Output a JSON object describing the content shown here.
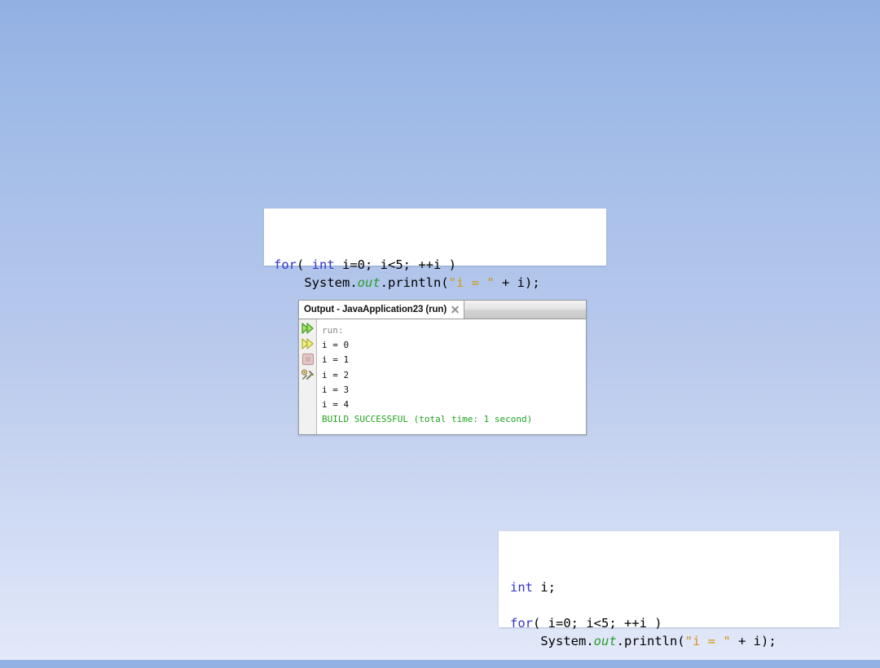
{
  "background": {
    "top_color": "#92b0e3",
    "bottom_color": "#e3e9f9"
  },
  "code_top": {
    "name": "for-loop-code-snippet",
    "lines": [
      [
        {
          "t": "for",
          "c": "kw"
        },
        {
          "t": "( ",
          "c": "plain"
        },
        {
          "t": "int",
          "c": "kw"
        },
        {
          "t": " i=0; i<5; ++i )",
          "c": "plain"
        }
      ],
      [
        {
          "t": "    System.",
          "c": "plain"
        },
        {
          "t": "out",
          "c": "field"
        },
        {
          "t": ".println(",
          "c": "plain"
        },
        {
          "t": "\"i = \"",
          "c": "str"
        },
        {
          "t": " + i);",
          "c": "plain"
        }
      ]
    ]
  },
  "code_bottom": {
    "name": "declared-variable-code-snippet",
    "lines": [
      [
        {
          "t": "int",
          "c": "kw"
        },
        {
          "t": " i;",
          "c": "plain"
        }
      ],
      [
        {
          "t": "",
          "c": "plain"
        }
      ],
      [
        {
          "t": "for",
          "c": "kw"
        },
        {
          "t": "( i=0; i<5; ++i )",
          "c": "plain"
        }
      ],
      [
        {
          "t": "    System.",
          "c": "plain"
        },
        {
          "t": "out",
          "c": "field"
        },
        {
          "t": ".println(",
          "c": "plain"
        },
        {
          "t": "\"i = \"",
          "c": "str"
        },
        {
          "t": " + i);",
          "c": "plain"
        }
      ]
    ]
  },
  "output_window": {
    "tab_title": "Output - JavaApplication23 (run)",
    "close_icon": "close-icon",
    "toolbar": [
      {
        "name": "rerun-icon",
        "label": "Re-run",
        "color_light": "#a8e06a",
        "color_dark": "#3f9a1e",
        "enabled": true
      },
      {
        "name": "rerun-alt-icon",
        "label": "Re-run with different parameters",
        "color_light": "#eef08a",
        "color_dark": "#b0b02a",
        "enabled": true
      },
      {
        "name": "stop-icon",
        "label": "Stop",
        "color_light": "#e3c6c6",
        "color_dark": "#c49a9a",
        "enabled": false
      },
      {
        "name": "settings-wrench-icon",
        "label": "Output settings",
        "color_light": "#d8d8c0",
        "color_dark": "#8a8a6a",
        "enabled": true
      }
    ],
    "lines": [
      {
        "text": "run:",
        "cls": "out-run"
      },
      {
        "text": "i = 0",
        "cls": "out-line"
      },
      {
        "text": "i = 1",
        "cls": "out-line"
      },
      {
        "text": "i = 2",
        "cls": "out-line"
      },
      {
        "text": "i = 3",
        "cls": "out-line"
      },
      {
        "text": "i = 4",
        "cls": "out-line"
      },
      {
        "text": "BUILD SUCCESSFUL (total time: 1 second)",
        "cls": "out-build"
      }
    ]
  }
}
